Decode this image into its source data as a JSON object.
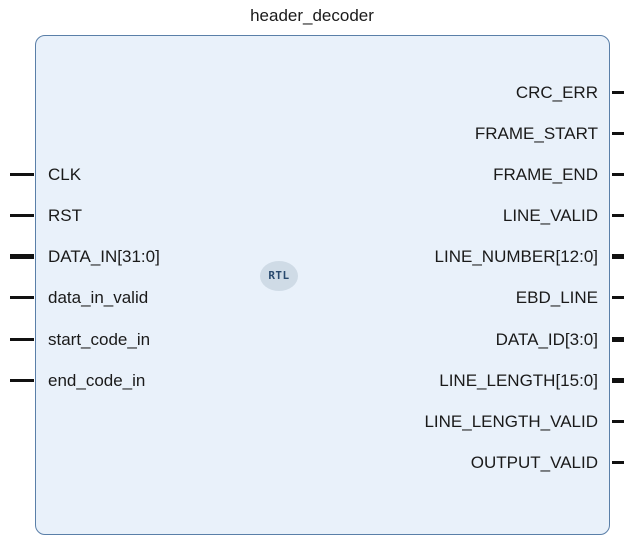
{
  "title": "header_decoder",
  "badge": "RTL",
  "inputs": [
    {
      "name": "CLK",
      "bus": false
    },
    {
      "name": "RST",
      "bus": false
    },
    {
      "name": "DATA_IN[31:0]",
      "bus": true
    },
    {
      "name": "data_in_valid",
      "bus": false
    },
    {
      "name": "start_code_in",
      "bus": false
    },
    {
      "name": "end_code_in",
      "bus": false
    }
  ],
  "outputs": [
    {
      "name": "CRC_ERR",
      "bus": false
    },
    {
      "name": "FRAME_START",
      "bus": false
    },
    {
      "name": "FRAME_END",
      "bus": false
    },
    {
      "name": "LINE_VALID",
      "bus": false
    },
    {
      "name": "LINE_NUMBER[12:0]",
      "bus": true
    },
    {
      "name": "EBD_LINE",
      "bus": false
    },
    {
      "name": "DATA_ID[3:0]",
      "bus": true
    },
    {
      "name": "LINE_LENGTH[15:0]",
      "bus": true
    },
    {
      "name": "LINE_LENGTH_VALID",
      "bus": false
    },
    {
      "name": "OUTPUT_VALID",
      "bus": false
    }
  ],
  "colors": {
    "block_fill": "#e9f1fa",
    "block_border": "#5a7fa8",
    "pin": "#111111"
  }
}
